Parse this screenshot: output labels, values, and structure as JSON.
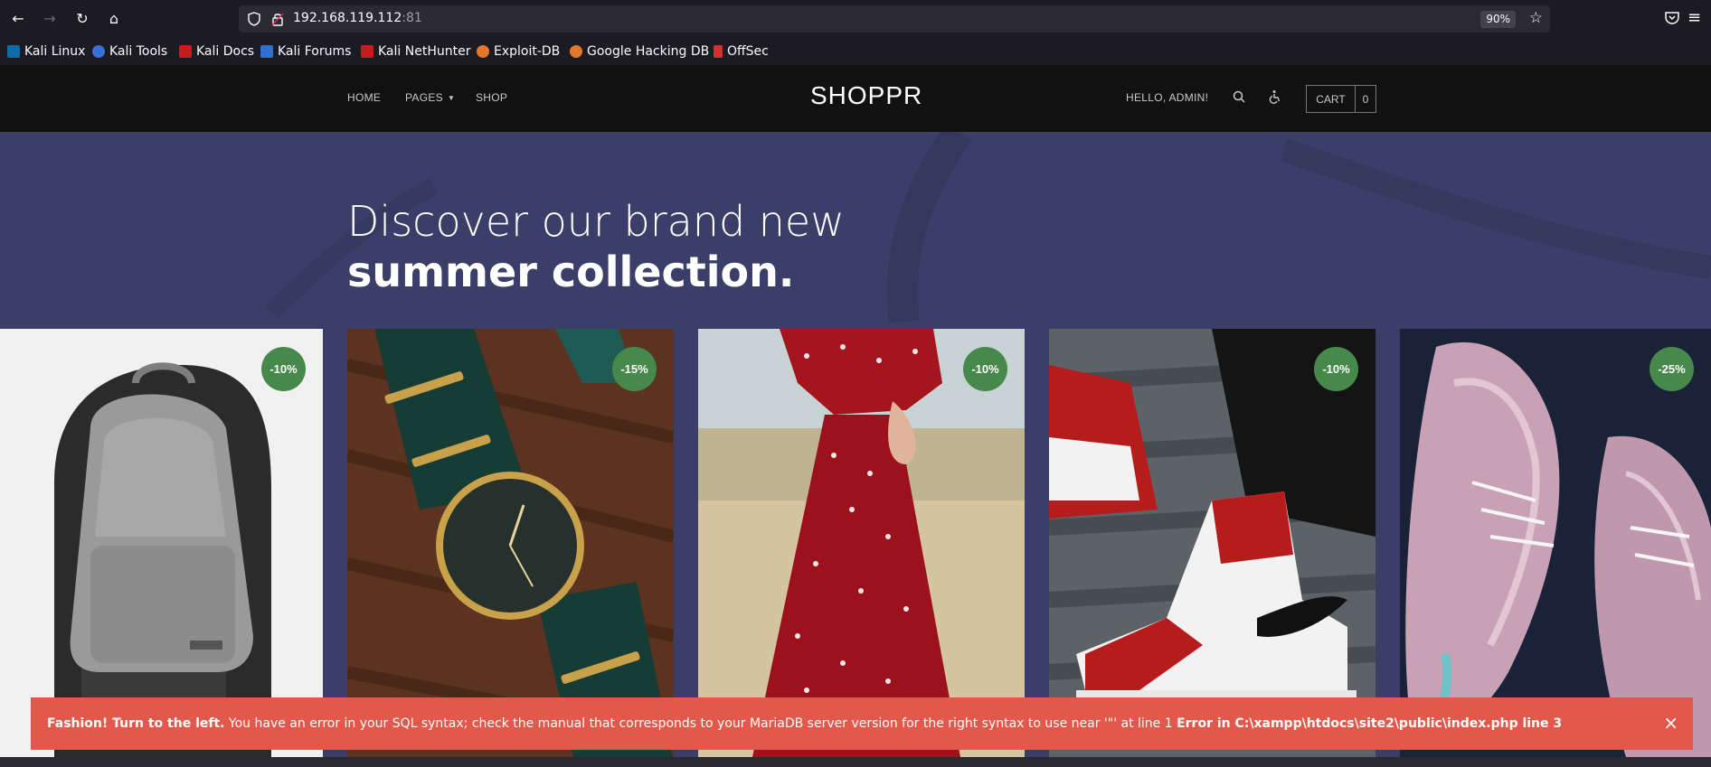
{
  "browser": {
    "url_host": "192.168.119.112",
    "url_port": ":81",
    "zoom": "90%"
  },
  "bookmarks": [
    {
      "label": "Kali Linux",
      "color": "#0d6ba8"
    },
    {
      "label": "Kali Tools",
      "color": "#3a6fd8"
    },
    {
      "label": "Kali Docs",
      "color": "#c41d1d"
    },
    {
      "label": "Kali Forums",
      "color": "#2f6fd0"
    },
    {
      "label": "Kali NetHunter",
      "color": "#c41d1d"
    },
    {
      "label": "Exploit-DB",
      "color": "#e3772b"
    },
    {
      "label": "Google Hacking DB",
      "color": "#e3772b"
    },
    {
      "label": "OffSec",
      "color": "#d3312f"
    }
  ],
  "header": {
    "nav": [
      {
        "label": "HOME"
      },
      {
        "label": "PAGES"
      },
      {
        "label": "SHOP"
      }
    ],
    "brand": "SHOPPR",
    "greeting": "HELLO, ADMIN!",
    "cart_label": "CART",
    "cart_count": "0"
  },
  "hero": {
    "line1": "Discover our brand new",
    "line2": "summer collection."
  },
  "products": [
    {
      "name": "backpack",
      "discount": "-10%"
    },
    {
      "name": "watch",
      "discount": "-15%"
    },
    {
      "name": "dress",
      "discount": "-10%"
    },
    {
      "name": "high-top sneakers",
      "discount": "-10%"
    },
    {
      "name": "knit sneakers",
      "discount": "-25%"
    }
  ],
  "alert": {
    "bold_lead": "Fashion! Turn to the left.",
    "message": " You have an error in your SQL syntax; check the manual that corresponds to your MariaDB server version for the right syntax to use near '\"' at line 1 ",
    "bold_tail": "Error in C:\\xampp\\htdocs\\site2\\public\\index.php line 3",
    "close": "×"
  },
  "colors": {
    "hero_bg": "#3a3e68",
    "header_bg": "#111111",
    "badge_green": "#46894a",
    "alert_red": "#e2584a"
  }
}
